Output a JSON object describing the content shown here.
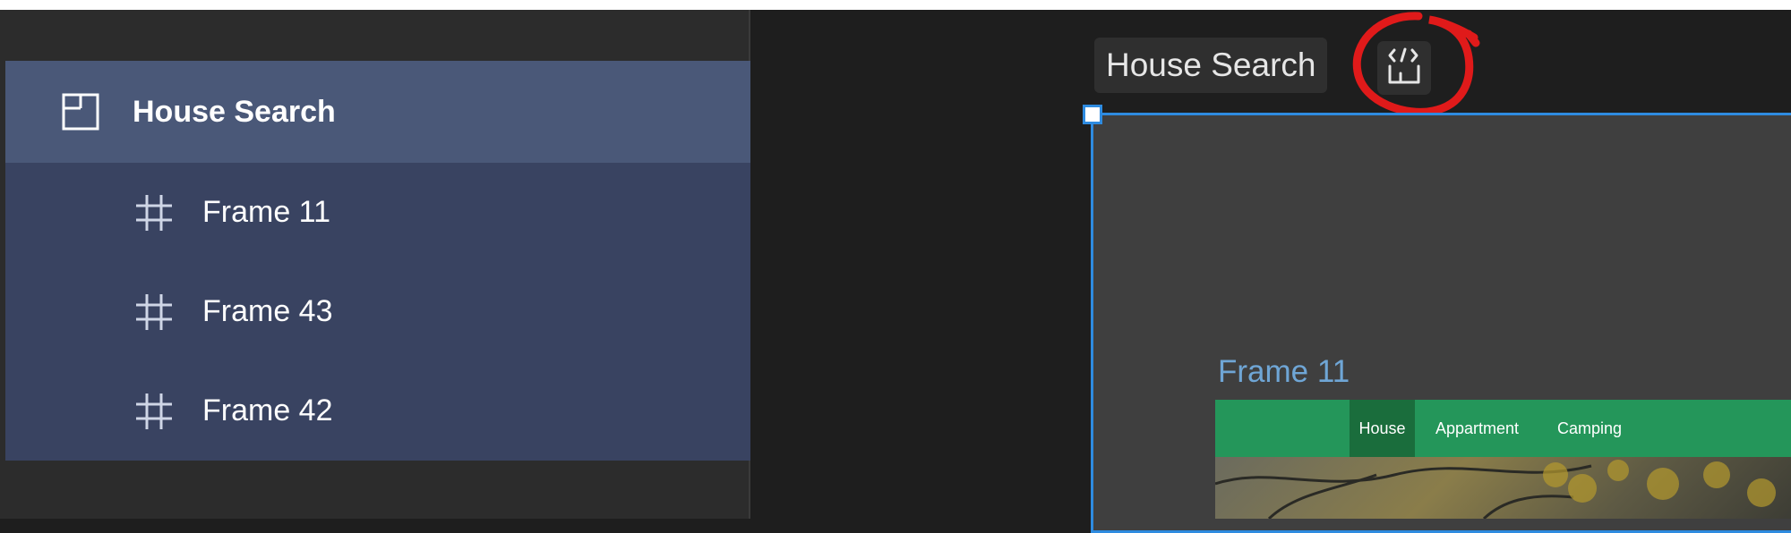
{
  "layers": {
    "page": {
      "label": "House Search",
      "icon": "page-icon"
    },
    "children": [
      {
        "label": "Frame 11",
        "icon": "frame-icon"
      },
      {
        "label": "Frame 43",
        "icon": "frame-icon"
      },
      {
        "label": "Frame 42",
        "icon": "frame-icon"
      }
    ]
  },
  "canvas": {
    "frame_title": "House Search",
    "dev_button_icon": "code-icon",
    "selected_frame": {
      "label": "Frame 11",
      "nav": [
        "House",
        "Appartment",
        "Camping"
      ]
    }
  },
  "colors": {
    "panel_bg": "#2c2c2c",
    "selected_row": "#4a5878",
    "child_row": "#394361",
    "selection_blue": "#2e8be0",
    "nav_green": "#24965a",
    "annotation_red": "#e01a1a"
  }
}
